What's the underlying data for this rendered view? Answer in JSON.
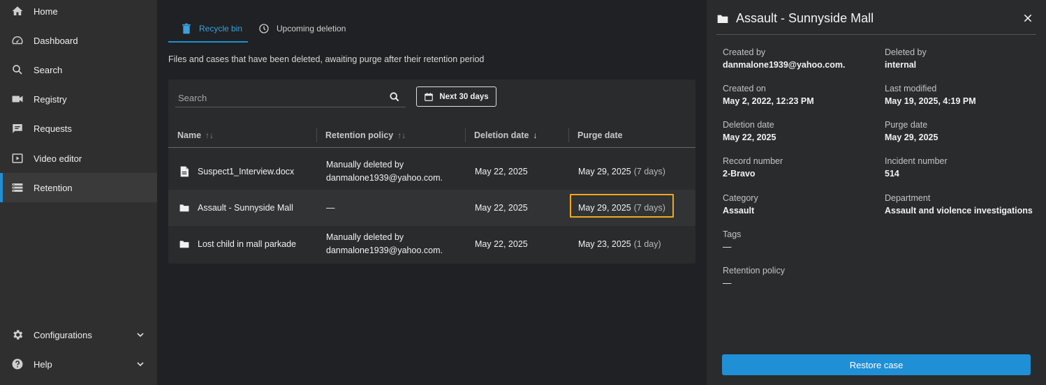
{
  "sidebar": {
    "items": [
      {
        "label": "Home",
        "icon": "home-icon"
      },
      {
        "label": "Dashboard",
        "icon": "gauge-icon"
      },
      {
        "label": "Search",
        "icon": "search-icon"
      },
      {
        "label": "Registry",
        "icon": "video-camera-icon"
      },
      {
        "label": "Requests",
        "icon": "chat-icon"
      },
      {
        "label": "Video editor",
        "icon": "video-editor-icon"
      },
      {
        "label": "Retention",
        "icon": "retention-icon"
      }
    ],
    "active": "Retention",
    "bottom": [
      {
        "label": "Configurations",
        "icon": "gear-icon"
      },
      {
        "label": "Help",
        "icon": "help-icon"
      }
    ]
  },
  "tabs": [
    {
      "label": "Recycle bin",
      "icon": "trash-icon",
      "active": true
    },
    {
      "label": "Upcoming deletion",
      "icon": "clock-icon",
      "active": false
    }
  ],
  "subtitle": "Files and cases that have been deleted, awaiting purge after their retention period",
  "search": {
    "placeholder": "Search",
    "value": ""
  },
  "date_filter": "Next 30 days",
  "table": {
    "headers": [
      "Name",
      "Retention policy",
      "Deletion date",
      "Purge date"
    ],
    "sort_icons": [
      "↑↓",
      "↑↓",
      "↓",
      ""
    ],
    "rows": [
      {
        "icon": "document-icon",
        "name": "Suspect1_Interview.docx",
        "policy_line1": "Manually deleted by",
        "policy_line2": "danmalone1939@yahoo.com.",
        "deletion": "May 22, 2025",
        "purge": "May 29, 2025",
        "days": "(7 days)"
      },
      {
        "icon": "folder-icon",
        "name": "Assault - Sunnyside Mall",
        "policy_line1": "—",
        "policy_line2": "",
        "deletion": "May 22, 2025",
        "purge": "May 29, 2025",
        "days": "(7 days)"
      },
      {
        "icon": "folder-icon",
        "name": "Lost child in mall parkade",
        "policy_line1": "Manually deleted by",
        "policy_line2": "danmalone1939@yahoo.com.",
        "deletion": "May 22, 2025",
        "purge": "May 23, 2025",
        "days": "(1 day)"
      }
    ]
  },
  "detail": {
    "title": "Assault - Sunnyside Mall",
    "fields": [
      {
        "label": "Created by",
        "value": "danmalone1939@yahoo.com."
      },
      {
        "label": "Deleted by",
        "value": "internal"
      },
      {
        "label": "Created on",
        "value": "May 2, 2022, 12:23 PM"
      },
      {
        "label": "Last modified",
        "value": "May 19, 2025, 4:19 PM"
      },
      {
        "label": "Deletion date",
        "value": "May 22, 2025"
      },
      {
        "label": "Purge date",
        "value": "May 29, 2025"
      },
      {
        "label": "Record number",
        "value": "2-Bravo"
      },
      {
        "label": "Incident number",
        "value": "514"
      },
      {
        "label": "Category",
        "value": "Assault"
      },
      {
        "label": "Department",
        "value": "Assault and violence investigations"
      },
      {
        "label": "Tags",
        "value": "—"
      },
      {
        "label": "Retention policy",
        "value": "—"
      }
    ],
    "restore_label": "Restore case"
  },
  "colors": {
    "accent": "#1f8fd6",
    "highlight": "#f0a81e"
  }
}
